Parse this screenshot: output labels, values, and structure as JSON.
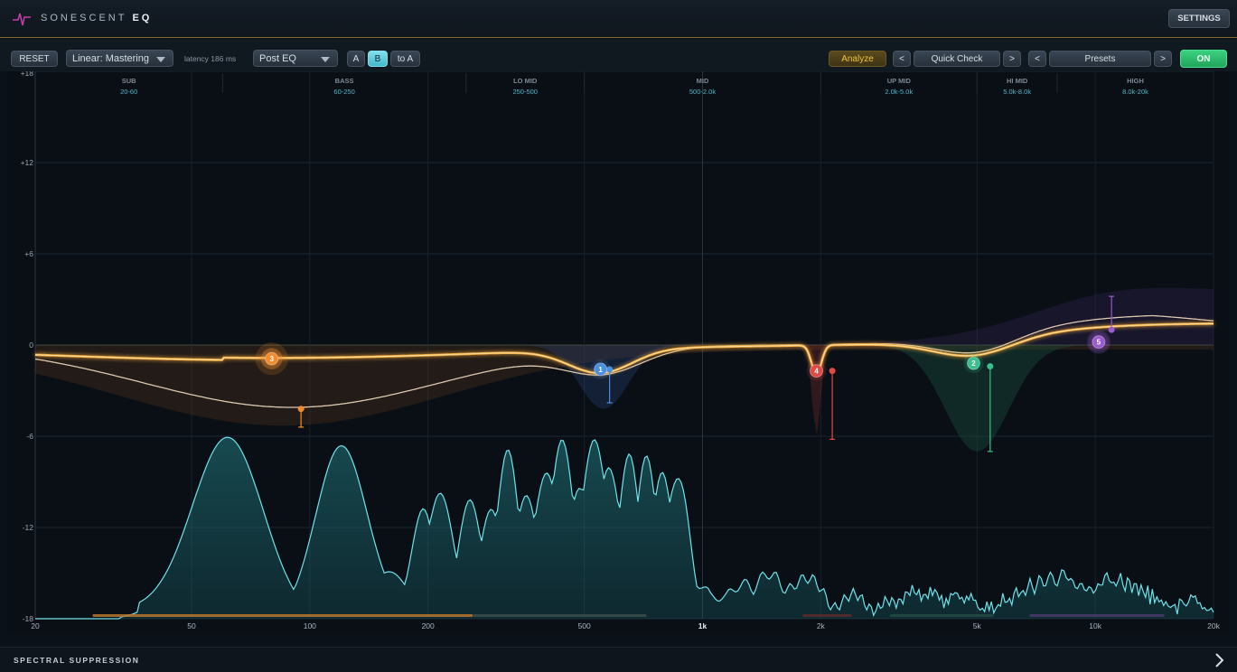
{
  "app": {
    "brand_name": "SONESCENT",
    "brand_product": "EQ",
    "settings_label": "SETTINGS"
  },
  "toolbar": {
    "reset_label": "RESET",
    "mode_value": "Linear: Mastering",
    "latency_text": "latency 186 ms",
    "position_value": "Post EQ",
    "a_label": "A",
    "b_label": "B",
    "to_a_label": "to A",
    "analyze_label": "Analyze",
    "quick_check_prev": "<",
    "quick_check_label": "Quick Check",
    "quick_check_next": ">",
    "presets_prev": "<",
    "presets_label": "Presets",
    "presets_next": ">",
    "on_label": "ON",
    "active_slot": "B"
  },
  "colors": {
    "accent": "#f0a93a",
    "band_1": "#4a8fe0",
    "band_2": "#3ac08a",
    "band_3": "#f08c2e",
    "band_4": "#e04a44",
    "band_5": "#9a5ad0",
    "spectrum": "#6fe3ea",
    "on_green": "#2fc06d"
  },
  "regions": [
    {
      "name": "SUB",
      "range": "20-60",
      "from": 20,
      "to": 60
    },
    {
      "name": "BASS",
      "range": "60-250",
      "from": 60,
      "to": 250
    },
    {
      "name": "LO MID",
      "range": "250-500",
      "from": 250,
      "to": 500
    },
    {
      "name": "MID",
      "range": "500-2.0k",
      "from": 500,
      "to": 2000
    },
    {
      "name": "UP MID",
      "range": "2.0k-5.0k",
      "from": 2000,
      "to": 5000
    },
    {
      "name": "HI MID",
      "range": "5.0k-8.0k",
      "from": 5000,
      "to": 8000
    },
    {
      "name": "HIGH",
      "range": "8.0k-20k",
      "from": 8000,
      "to": 20000
    }
  ],
  "db_axis": {
    "min": -18,
    "max": 18,
    "ticks": [
      {
        "value": 18,
        "label": "+18"
      },
      {
        "value": 12,
        "label": "+12"
      },
      {
        "value": 6,
        "label": "+6"
      },
      {
        "value": 0,
        "label": "0"
      },
      {
        "value": -6,
        "label": "-6"
      },
      {
        "value": -12,
        "label": "-12"
      },
      {
        "value": -18,
        "label": "-18"
      }
    ]
  },
  "freq_axis": {
    "min": 20,
    "max": 20000,
    "scale": "log",
    "ticks": [
      {
        "value": 20,
        "label": "20"
      },
      {
        "value": 50,
        "label": "50"
      },
      {
        "value": 100,
        "label": "100"
      },
      {
        "value": 200,
        "label": "200"
      },
      {
        "value": 500,
        "label": "500"
      },
      {
        "value": 1000,
        "label": "1k"
      },
      {
        "value": 2000,
        "label": "2k"
      },
      {
        "value": 5000,
        "label": "5k"
      },
      {
        "value": 10000,
        "label": "10k"
      },
      {
        "value": 20000,
        "label": "20k"
      }
    ]
  },
  "bands": [
    {
      "id": "1",
      "label": "1",
      "freq": 550,
      "gain": -1.6,
      "type": "bell",
      "color": "#4a8fe0",
      "handle_freq": 580,
      "handle_gain": -1.6,
      "range_min": -3.8
    },
    {
      "id": "2",
      "label": "2",
      "freq": 4900,
      "gain": -1.2,
      "type": "bell",
      "color": "#3ac08a",
      "handle_freq": 5400,
      "handle_gain": -1.4,
      "range_min": -7.0
    },
    {
      "id": "3",
      "label": "3",
      "freq": 80,
      "gain": -0.9,
      "type": "bell",
      "color": "#f08c2e",
      "handle_freq": 95,
      "handle_gain": -4.2,
      "range_min": -5.4
    },
    {
      "id": "4",
      "label": "4",
      "freq": 1950,
      "gain": -1.7,
      "type": "notch",
      "color": "#e04a44",
      "handle_freq": 2140,
      "handle_gain": -1.7,
      "range_min": -6.2
    },
    {
      "id": "5",
      "label": "5",
      "freq": 10200,
      "gain": 0.2,
      "type": "high-shelf",
      "color": "#9a5ad0",
      "handle_freq": 11000,
      "handle_gain": 1.0,
      "range_max": 3.2
    }
  ],
  "spectral_suppression_label": "SPECTRAL SUPPRESSION"
}
